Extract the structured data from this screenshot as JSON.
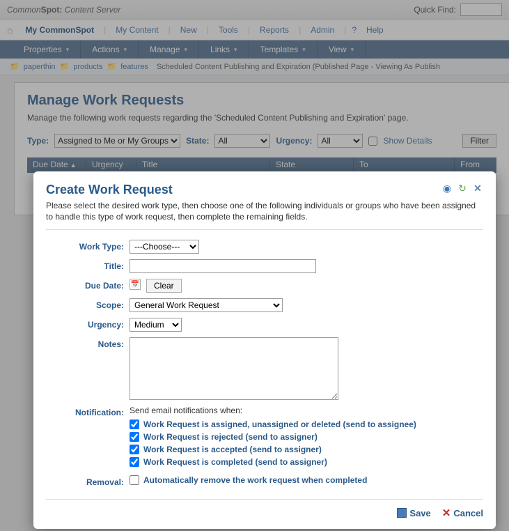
{
  "topbar": {
    "brand_a": "Common",
    "brand_b": "Spot:",
    "brand_c": "Content Server",
    "quick_find_label": "Quick Find:"
  },
  "nav": {
    "items": [
      "My CommonSpot",
      "My Content",
      "New",
      "Tools",
      "Reports",
      "Admin"
    ],
    "help": "Help"
  },
  "toolbar": {
    "items": [
      "Properties",
      "Actions",
      "Manage",
      "Links",
      "Templates",
      "View"
    ]
  },
  "breadcrumb": {
    "folders": [
      "paperthin",
      "products",
      "features"
    ],
    "trail": "Scheduled Content Publishing and Expiration (Published Page - Viewing As Publish"
  },
  "page": {
    "title": "Manage Work Requests",
    "desc": "Manage the following work requests regarding the 'Scheduled Content Publishing and Expiration' page.",
    "filters": {
      "type_label": "Type:",
      "type_value": "Assigned to Me or My Groups",
      "state_label": "State:",
      "state_value": "All",
      "urgency_label": "Urgency:",
      "urgency_value": "All",
      "show_details": "Show Details",
      "filter_btn": "Filter"
    },
    "columns": [
      "Due Date",
      "Urgency",
      "Title",
      "State",
      "To",
      "From"
    ]
  },
  "dialog": {
    "title": "Create Work Request",
    "desc": "Please select the desired work type, then choose one of the following individuals or groups who have been assigned to handle this type of work request, then complete the remaining fields.",
    "labels": {
      "work_type": "Work Type:",
      "title": "Title:",
      "due_date": "Due Date:",
      "scope": "Scope:",
      "urgency": "Urgency:",
      "notes": "Notes:",
      "notification": "Notification:",
      "removal": "Removal:"
    },
    "work_type_value": "---Choose---",
    "title_value": "",
    "clear_btn": "Clear",
    "scope_value": "General Work Request",
    "urgency_value": "Medium",
    "notes_value": "",
    "notif_head": "Send email notifications when:",
    "notifications": [
      {
        "checked": true,
        "label": "Work Request is assigned, unassigned or deleted (send to assignee)"
      },
      {
        "checked": true,
        "label": "Work Request is rejected (send to assigner)"
      },
      {
        "checked": true,
        "label": "Work Request is accepted (send to assigner)"
      },
      {
        "checked": true,
        "label": "Work Request is completed (send to assigner)"
      }
    ],
    "removal_label": "Automatically remove the work request when completed",
    "removal_checked": false,
    "save": "Save",
    "cancel": "Cancel"
  }
}
